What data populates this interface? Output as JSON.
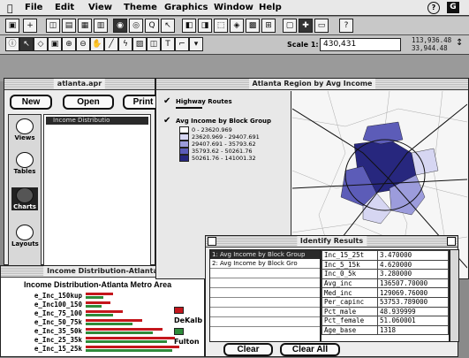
{
  "menubar": {
    "items": [
      "File",
      "Edit",
      "View",
      "Theme",
      "Graphics",
      "Window",
      "Help"
    ]
  },
  "toolbar": {
    "scale_label": "Scale 1:",
    "scale_value": "430,431",
    "coord_top": "113,936.48",
    "coord_bottom": "33,944.48"
  },
  "project_window": {
    "title": "atlanta.apr",
    "buttons": [
      "New",
      "Open",
      "Print"
    ],
    "icons": [
      "Views",
      "Tables",
      "Charts",
      "Layouts"
    ],
    "selected_item": "Income Distributio"
  },
  "view_window": {
    "title": "Atlanta Region by Avg Income",
    "legend": {
      "layer1": "Highway Routes",
      "layer2": "Avg Income by Block Group",
      "classes": [
        {
          "label": "0 - 23620.969",
          "color": "#ffffff"
        },
        {
          "label": "23620.969 - 29407.691",
          "color": "#d6d6f2"
        },
        {
          "label": "29407.691 - 35793.62",
          "color": "#9c9cdc"
        },
        {
          "label": "35793.62 - 50261.76",
          "color": "#5c5cb8"
        },
        {
          "label": "50261.76 - 141001.32",
          "color": "#27277e"
        }
      ]
    }
  },
  "chart_window": {
    "title": "Income Distribution-Atlanta",
    "chart_data": {
      "type": "bar",
      "title": "Income Distribution-Atlanta Metro Area",
      "categories": [
        "e_Inc_150kup",
        "e_Inc100_150",
        "e_Inc_75_100",
        "e_Inc_50_75k",
        "e_Inc_35_50k",
        "e_Inc_25_35k",
        "e_Inc_15_25k"
      ],
      "series": [
        {
          "name": "DeKalb",
          "color": "#c4161c",
          "values": [
            0.22,
            0.2,
            0.3,
            0.46,
            0.62,
            0.72,
            0.76
          ]
        },
        {
          "name": "Fulton",
          "color": "#2e8b3a",
          "values": [
            0.14,
            0.13,
            0.22,
            0.38,
            0.54,
            0.66,
            0.7
          ]
        }
      ],
      "legend": [
        "DeKalb",
        "Fulton"
      ]
    }
  },
  "identify_window": {
    "title": "Identify Results",
    "list": [
      "1: Avg Income by Block Group",
      "2: Avg Income by Block Gro"
    ],
    "rows": [
      [
        "Inc_15_25t",
        "3.470000"
      ],
      [
        "Inc_5_15k",
        "4.620000"
      ],
      [
        "Inc_0_5k",
        "3.280000"
      ],
      [
        "Avg_inc",
        "136507.70000"
      ],
      [
        "Med_inc",
        "129069.76000"
      ],
      [
        "Per_capinc",
        "53753.789000"
      ],
      [
        "Pct_male",
        "48.939999"
      ],
      [
        "Pct_female",
        "51.060001"
      ],
      [
        "Age_base",
        "1318"
      ]
    ],
    "buttons": [
      "Clear",
      "Clear All"
    ]
  },
  "colors": {
    "accent": "#2b2b8a",
    "dekalb": "#c4161c",
    "fulton": "#2e8b3a"
  }
}
